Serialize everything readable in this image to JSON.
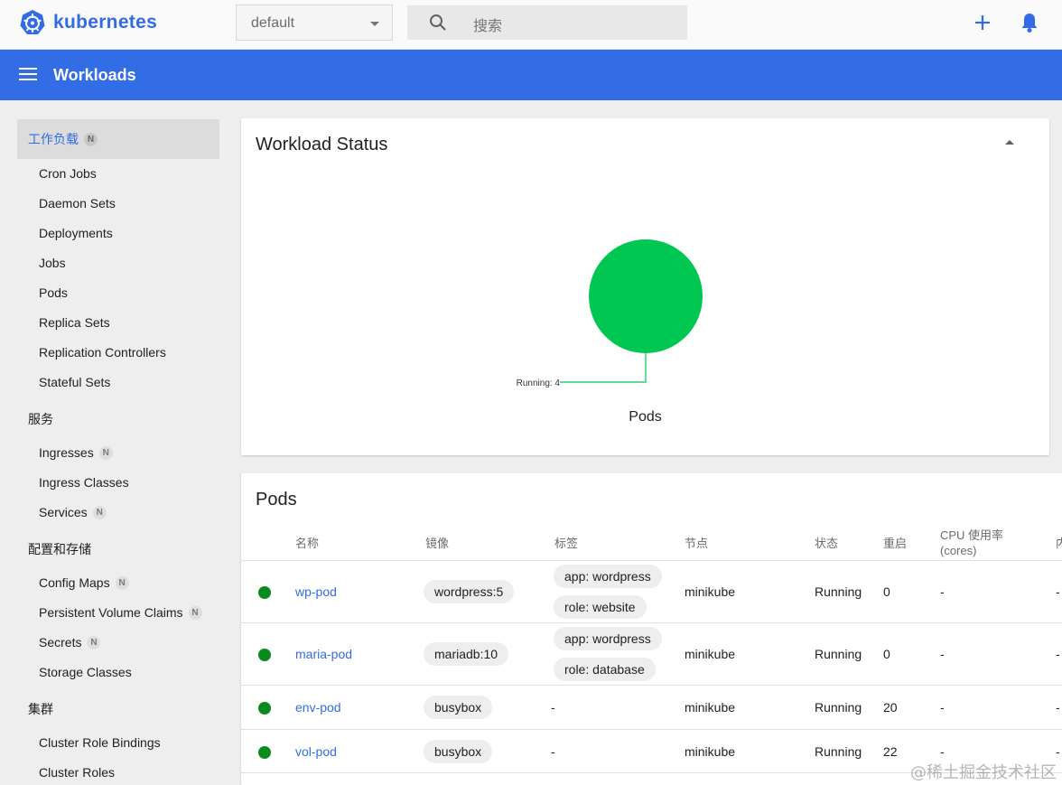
{
  "header": {
    "logo_text": "kubernetes",
    "namespace": "default",
    "search_placeholder": "搜索"
  },
  "appbar": {
    "title": "Workloads"
  },
  "sidebar": {
    "active": {
      "label": "工作负载",
      "badge": "N"
    },
    "workloads": [
      "Cron Jobs",
      "Daemon Sets",
      "Deployments",
      "Jobs",
      "Pods",
      "Replica Sets",
      "Replication Controllers",
      "Stateful Sets"
    ],
    "services_section": "服务",
    "services": [
      {
        "label": "Ingresses",
        "badge": "N"
      },
      {
        "label": "Ingress Classes",
        "badge": ""
      },
      {
        "label": "Services",
        "badge": "N"
      }
    ],
    "config_section": "配置和存储",
    "config": [
      {
        "label": "Config Maps",
        "badge": "N"
      },
      {
        "label": "Persistent Volume Claims",
        "badge": "N"
      },
      {
        "label": "Secrets",
        "badge": "N"
      },
      {
        "label": "Storage Classes",
        "badge": ""
      }
    ],
    "cluster_section": "集群",
    "cluster": [
      "Cluster Role Bindings",
      "Cluster Roles"
    ]
  },
  "workload_status": {
    "title": "Workload Status",
    "pie_label": "Running: 4",
    "caption": "Pods"
  },
  "chart_data": {
    "type": "pie",
    "title": "Pods",
    "categories": [
      "Running"
    ],
    "values": [
      4
    ],
    "colors": [
      "#00c752"
    ]
  },
  "pods": {
    "title": "Pods",
    "columns": [
      "名称",
      "镜像",
      "标签",
      "节点",
      "状态",
      "重启",
      "CPU 使用率",
      "(cores)",
      "内"
    ],
    "rows": [
      {
        "name": "wp-pod",
        "image": "wordpress:5",
        "labels": [
          "app: wordpress",
          "role: website"
        ],
        "node": "minikube",
        "status": "Running",
        "restarts": "0",
        "cpu": "-",
        "mem": "-"
      },
      {
        "name": "maria-pod",
        "image": "mariadb:10",
        "labels": [
          "app: wordpress",
          "role: database"
        ],
        "node": "minikube",
        "status": "Running",
        "restarts": "0",
        "cpu": "-",
        "mem": "-"
      },
      {
        "name": "env-pod",
        "image": "busybox",
        "labels_text": "-",
        "node": "minikube",
        "status": "Running",
        "restarts": "20",
        "cpu": "-",
        "mem": "-"
      },
      {
        "name": "vol-pod",
        "image": "busybox",
        "labels_text": "-",
        "node": "minikube",
        "status": "Running",
        "restarts": "22",
        "cpu": "-",
        "mem": "-"
      }
    ],
    "status_color": "#0b8a1e"
  },
  "watermark": "@稀土掘金技术社区",
  "colors": {
    "brand": "#326ce5",
    "appbar": "#326de6",
    "running": "#00c752"
  }
}
